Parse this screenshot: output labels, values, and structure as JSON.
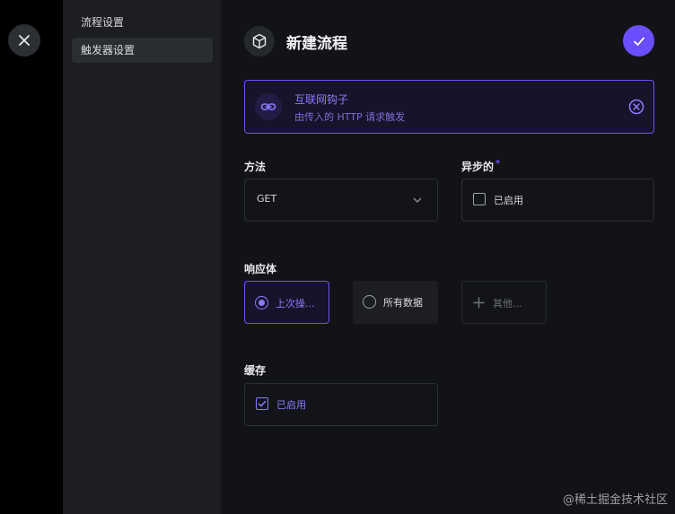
{
  "close_icon": "close-icon",
  "sidebar": {
    "items": [
      {
        "label": "流程设置",
        "active": false
      },
      {
        "label": "触发器设置",
        "active": true
      }
    ]
  },
  "header": {
    "title": "新建流程",
    "icon": "cube-icon",
    "confirm_icon": "check-icon",
    "accent": "#6b4eff"
  },
  "trigger": {
    "title": "互联网钩子",
    "subtitle": "由传入的 HTTP 请求触发",
    "icon": "link-icon",
    "clear_icon": "circle-x-icon"
  },
  "method": {
    "label": "方法",
    "value": "GET"
  },
  "async": {
    "label": "异步的",
    "required_mark": "*",
    "checkbox_label": "已启用",
    "checked": false
  },
  "response_body": {
    "label": "响应体",
    "options": [
      {
        "label": "上次操...",
        "selected": true
      },
      {
        "label": "所有数据",
        "selected": false
      },
      {
        "label": "其他...",
        "selected": false
      }
    ]
  },
  "cache": {
    "label": "缓存",
    "checkbox_label": "已启用",
    "checked": true
  },
  "watermark": "@稀土掘金技术社区"
}
